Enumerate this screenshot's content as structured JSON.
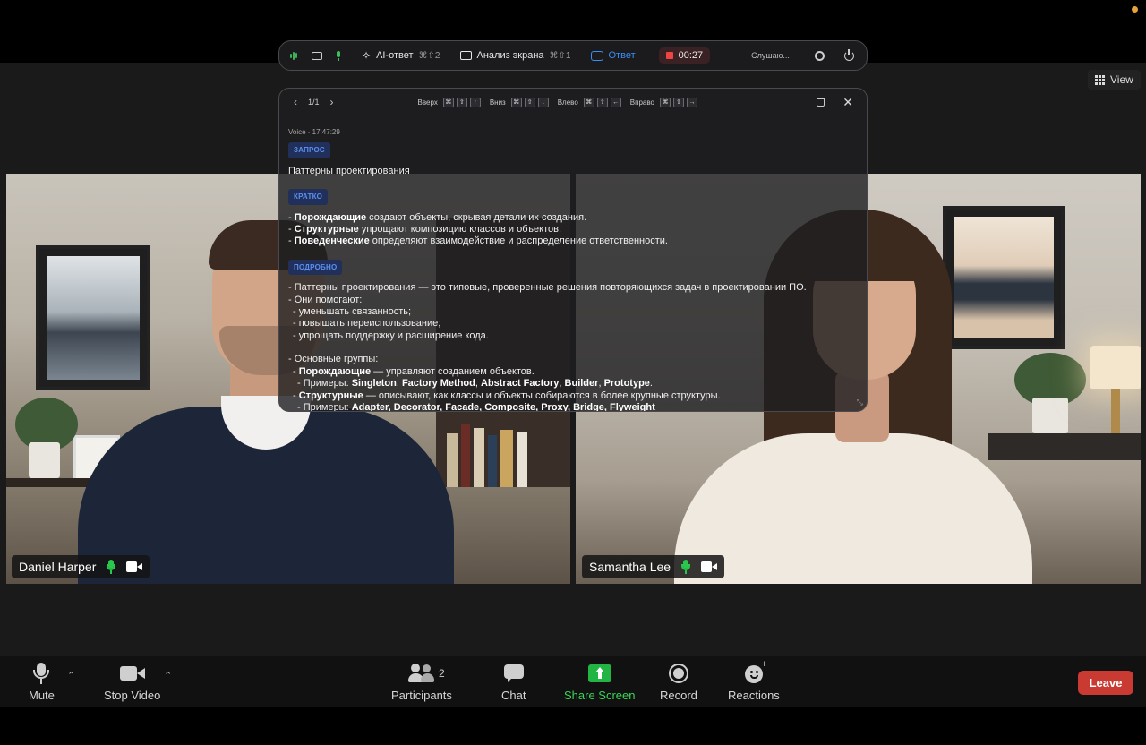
{
  "window": {
    "view_label": "View"
  },
  "participants": [
    {
      "name": "Daniel Harper",
      "mic": "on",
      "video": "on"
    },
    {
      "name": "Samantha Lee",
      "mic": "on",
      "video": "on"
    }
  ],
  "toolbar": {
    "mute_label": "Mute",
    "stop_video_label": "Stop Video",
    "participants_label": "Participants",
    "participants_count": "2",
    "chat_label": "Chat",
    "share_screen_label": "Share Screen",
    "record_label": "Record",
    "reactions_label": "Reactions",
    "leave_label": "Leave"
  },
  "ai_bar": {
    "ai_answer_label": "AI-ответ",
    "ai_answer_shortcut": "⌘⇧2",
    "screen_analysis_label": "Анализ экрана",
    "screen_analysis_shortcut": "⌘⇧1",
    "answer_label": "Ответ",
    "timer": "00:27",
    "status": "Слушаю..."
  },
  "ai_panel": {
    "pager": "1/1",
    "shortcuts": [
      {
        "label": "Вверх",
        "keys": [
          "⌘",
          "⇧",
          "↑"
        ]
      },
      {
        "label": "Вниз",
        "keys": [
          "⌘",
          "⇧",
          "↓"
        ]
      },
      {
        "label": "Влево",
        "keys": [
          "⌘",
          "⇧",
          "←"
        ]
      },
      {
        "label": "Вправо",
        "keys": [
          "⌘",
          "⇧",
          "→"
        ]
      }
    ],
    "meta": "Voice · 17:47:29",
    "request_tag": "ЗАПРОС",
    "request_text": "Паттерны проектирования",
    "brief_tag": "КРАТКО",
    "brief": [
      {
        "bold": "Порождающие",
        "rest": " создают объекты, скрывая детали их создания."
      },
      {
        "bold": "Структурные",
        "rest": " упрощают композицию классов и объектов."
      },
      {
        "bold": "Поведенческие",
        "rest": " определяют взаимодействие и распределение ответственности."
      }
    ],
    "detail_tag": "ПОДРОБНО",
    "detail": {
      "l1": "- Паттерны проектирования — это типовые, проверенные решения повторяющихся задач в проектировании ПО.",
      "l2": "- Они помогают:",
      "l3": "- уменьшать связанность;",
      "l4": "- повышать переиспользование;",
      "l5": "- упрощать поддержку и расширение кода.",
      "l6": "- Основные группы:",
      "l7_bold": "Порождающие",
      "l7_rest": " — управляют созданием объектов.",
      "l8_prefix": "- Примеры: ",
      "l8_items": [
        "Singleton",
        "Factory Method",
        "Abstract Factory",
        "Builder",
        "Prototype"
      ],
      "l9_bold": "Структурные",
      "l9_rest": " — описывают, как классы и объекты собираются в более крупные структуры.",
      "l10_prefix": "- Примеры: ",
      "l10_items": "Adapter, Decorator, Facade, Composite, Proxy, Bridge, Flyweight"
    }
  }
}
